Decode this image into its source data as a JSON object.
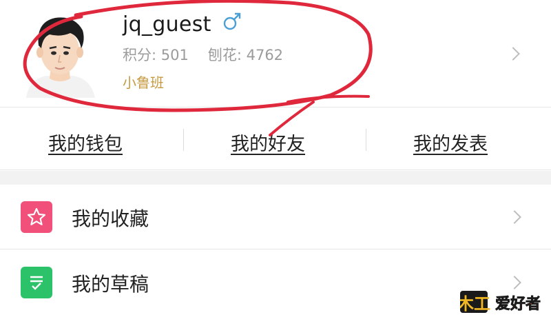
{
  "profile": {
    "username": "jq_guest",
    "gender_symbol": "♂",
    "gender_icon": "male-icon",
    "stats": [
      {
        "text": "积分: 501"
      },
      {
        "text": "刨花: 4762"
      }
    ],
    "rank": "小鲁班"
  },
  "quick_links": [
    {
      "label": "我的钱包"
    },
    {
      "label": "我的好友"
    },
    {
      "label": "我的发表"
    }
  ],
  "menu": [
    {
      "label": "我的收藏",
      "icon": "star-icon",
      "color": "#f0507a"
    },
    {
      "label": "我的草稿",
      "icon": "draft-list-icon",
      "color": "#2cc26a"
    }
  ],
  "colors": {
    "rank": "#c79a3f",
    "gender": "#4a9fd6",
    "annotation": "#e0283c"
  },
  "watermark": {
    "text": "木工爱好者"
  }
}
